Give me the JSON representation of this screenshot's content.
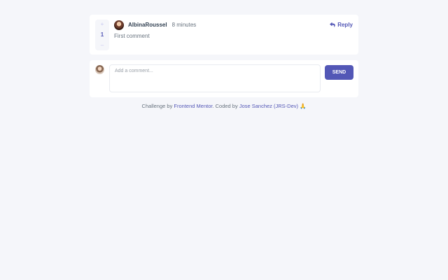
{
  "comment": {
    "score": "1",
    "upvote_label": "+",
    "downvote_label": "–",
    "username": "AlbinaRoussel",
    "time": "8 minutes",
    "reply_label": "Reply",
    "text": "First comment"
  },
  "add_comment": {
    "placeholder": "Add a comment...",
    "value": "",
    "send_label": "SEND"
  },
  "attribution": {
    "prefix": "Challenge by ",
    "challenge_link": "Frontend Mentor",
    "middle": ". Coded by ",
    "author_link": "Jose Sanchez (JRS-Dev)",
    "emoji": "🙏"
  },
  "colors": {
    "accent": "#5357b6",
    "background": "#f5f6fa",
    "card": "#ffffff",
    "text": "#67727e",
    "username": "#334253"
  },
  "icons": {
    "reply": "reply-arrow-icon",
    "avatar": "user-avatar",
    "current_user_avatar": "current-user-avatar"
  }
}
